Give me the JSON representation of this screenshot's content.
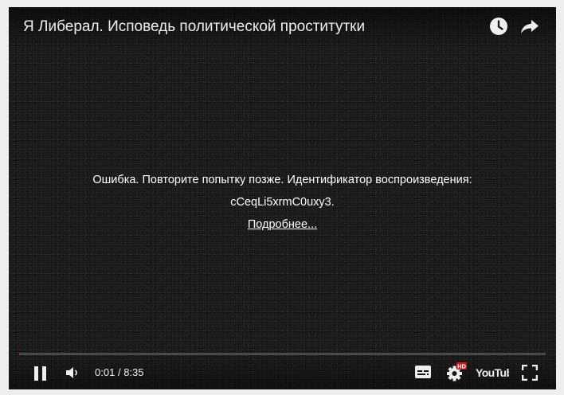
{
  "video": {
    "title": "Я Либерал. Исповедь политической проститутки"
  },
  "error": {
    "message": "Ошибка. Повторите попытку позже. Идентификатор воспроизведения:",
    "playback_id": "cCeqLi5xrmC0uxy3.",
    "more_link": "Подробнее..."
  },
  "controls": {
    "current_time": "0:01",
    "separator": "/",
    "duration": "8:35",
    "progress_fraction": 0.002,
    "hd_badge": "HD",
    "logo_text": "YouTube"
  },
  "icons": {
    "top": [
      "clock-icon",
      "share-icon"
    ],
    "bottom": [
      "pause-icon",
      "volume-icon",
      "subtitles-icon",
      "settings-icon",
      "youtube-logo-icon",
      "fullscreen-icon"
    ]
  },
  "colors": {
    "progress_played": "#cc181e",
    "hd_badge": "#cc181e"
  }
}
